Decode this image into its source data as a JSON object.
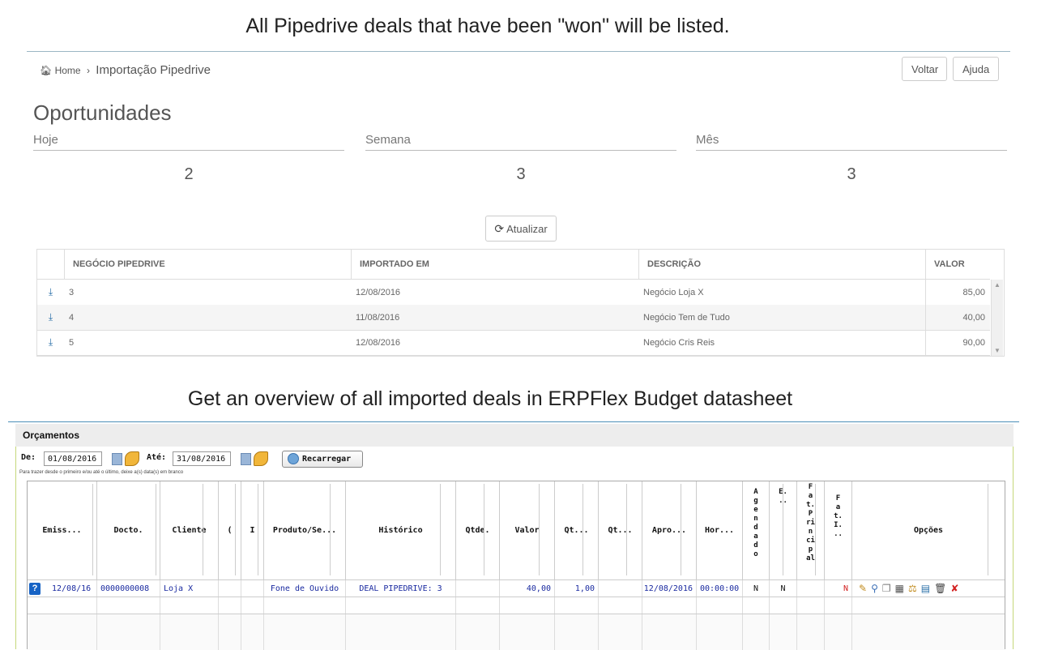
{
  "captions": {
    "top": "All Pipedrive deals that have been \"won\"  will be listed.",
    "bottom": "Get an overview of all imported deals in ERPFlex Budget datasheet"
  },
  "pipedrive": {
    "breadcrumb": {
      "home": "Home",
      "current": "Importação Pipedrive"
    },
    "buttons": {
      "back": "Voltar",
      "help": "Ajuda",
      "refresh": "Atualizar"
    },
    "title": "Oportunidades",
    "stats": [
      {
        "label": "Hoje",
        "value": "2"
      },
      {
        "label": "Semana",
        "value": "3"
      },
      {
        "label": "Mês",
        "value": "3"
      }
    ],
    "table": {
      "headers": [
        "NEGÓCIO PIPEDRIVE",
        "IMPORTADO EM",
        "DESCRIÇÃO",
        "VALOR"
      ],
      "rows": [
        {
          "deal": "3",
          "imported": "12/08/2016",
          "description": "Negócio Loja X",
          "value": "85,00"
        },
        {
          "deal": "4",
          "imported": "11/08/2016",
          "description": "Negócio Tem de Tudo",
          "value": "40,00"
        },
        {
          "deal": "5",
          "imported": "12/08/2016",
          "description": "Negócio Cris Reis",
          "value": "90,00"
        }
      ]
    }
  },
  "erpflex": {
    "title": "Orçamentos",
    "filters": {
      "from_label": "De:",
      "from_value": "01/08/2016",
      "to_label": "Até:",
      "to_value": "31/08/2016",
      "reload": "Recarregar",
      "hint": "Para trazer desde o primeiro e/ou até o último, deixe a(s) data(s) em branco"
    },
    "headers": {
      "emissao": "Emiss...",
      "docto": "Docto.",
      "cliente": "Cliente",
      "c": "(",
      "f": "I",
      "produto": "Produto/Se...",
      "historico": "Histórico",
      "qtde": "Qtde.",
      "valor": "Valor",
      "qt1": "Qt...",
      "qt2": "Qt...",
      "aprov": "Apro...",
      "hora": "Hor...",
      "agendado": "A\ng\ne\nn\nd\na\nd\no",
      "e": "E.\n..",
      "fat_principal": "F\na\nt.\nP\nri\nn\nci\np\nal",
      "fat_i": "F\na\nt.\nI.\n..",
      "opcoes": "Opções"
    },
    "row": {
      "emissao": "12/08/16",
      "docto": "0000000008",
      "cliente": "Loja X",
      "produto": "Fone de Ouvido",
      "historico": "DEAL PIPEDRIVE: 3",
      "valor": "40,00",
      "qt1": "1,00",
      "aprov": "12/08/2016",
      "hora": "00:00:00",
      "agendado": "N",
      "e": "N",
      "fat_i": "N"
    },
    "colors": {
      "accent_red": "#d21f1f",
      "link_blue": "#1a2aa0"
    }
  }
}
